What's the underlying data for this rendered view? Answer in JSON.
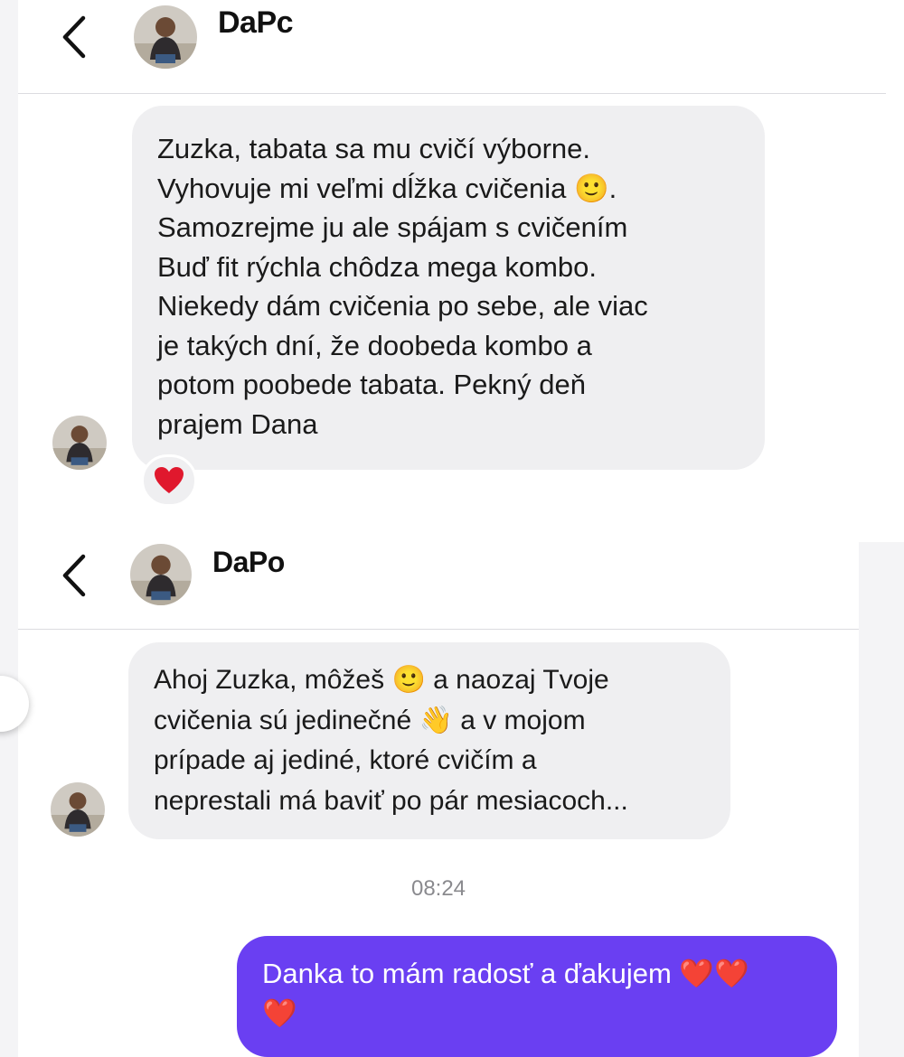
{
  "chat1": {
    "contact_name": "DaPc",
    "message": "Zuzka, tabata sa mu cvičí výborne.\nVyhovuje mi veľmi dĺžka cvičenia 🙂.\nSamozrejme ju ale spájam s cvičením\nBuď fit rýchla chôdza mega kombo.\nNiekedy dám cvičenia po sebe, ale viac\nje takých dní, že doobeda kombo a\npotom poobede tabata. Pekný deň\nprajem Dana",
    "reaction": "❤️"
  },
  "chat2": {
    "contact_name": "DaPo",
    "message": "Ahoj Zuzka, môžeš 🙂 a naozaj Tvoje\ncvičenia sú jedinečné 👋 a v mojom\nprípade aj jediné, ktoré cvičím a\nneprestali má baviť po pár mesiacoch...",
    "timestamp": "08:24",
    "reply": "Danka to mám radosť a ďakujem ❤️❤️\n❤️"
  },
  "colors": {
    "incoming_bubble": "#efeff1",
    "outgoing_bubble": "#6a3ff2",
    "heart": "#e0182d"
  },
  "icons": [
    "back-chevron-icon",
    "heart-icon",
    "smiley-icon",
    "waving-hand-icon"
  ]
}
